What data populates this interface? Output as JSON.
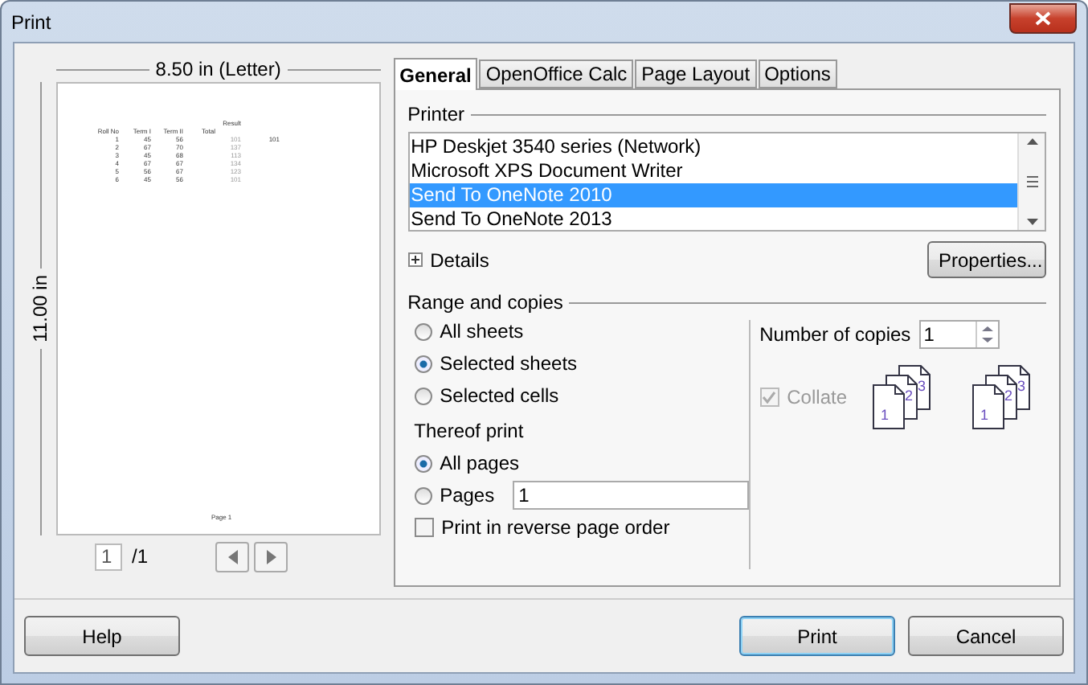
{
  "window": {
    "title": "Print"
  },
  "preview": {
    "width_label": "8.50 in (Letter)",
    "height_label": "11.00 in",
    "page": {
      "result_header": "Result",
      "headers": [
        "Roll No",
        "Term I",
        "Term II",
        "Total"
      ],
      "rows": [
        [
          "1",
          "45",
          "56",
          "101"
        ],
        [
          "2",
          "67",
          "70",
          "137"
        ],
        [
          "3",
          "45",
          "68",
          "113"
        ],
        [
          "4",
          "67",
          "67",
          "134"
        ],
        [
          "5",
          "56",
          "67",
          "123"
        ],
        [
          "6",
          "45",
          "56",
          "101"
        ]
      ],
      "side_value": "101",
      "footer": "Page 1"
    },
    "page_number": "1",
    "page_count": "/1"
  },
  "tabs": [
    {
      "label": "General",
      "selected": true
    },
    {
      "label": "OpenOffice Calc",
      "selected": false
    },
    {
      "label": "Page Layout",
      "selected": false
    },
    {
      "label": "Options",
      "selected": false
    }
  ],
  "printer": {
    "label": "Printer",
    "items": [
      {
        "name": "HP Deskjet 3540 series (Network)",
        "selected": false
      },
      {
        "name": "Microsoft XPS Document Writer",
        "selected": false
      },
      {
        "name": "Send To OneNote 2010",
        "selected": true
      },
      {
        "name": "Send To OneNote 2013",
        "selected": false
      }
    ],
    "details": "Details",
    "details_expanded": false,
    "properties": "Properties..."
  },
  "range": {
    "label": "Range and copies",
    "sheet_options": [
      {
        "label": "All sheets",
        "selected": false
      },
      {
        "label": "Selected sheets",
        "selected": true
      },
      {
        "label": "Selected cells",
        "selected": false
      }
    ],
    "thereof_label": "Thereof print",
    "page_options": [
      {
        "label": "All pages",
        "selected": true
      },
      {
        "label": "Pages",
        "selected": false
      }
    ],
    "pages_value": "1",
    "reverse": {
      "label": "Print in reverse page order",
      "checked": false
    },
    "copies_label": "Number of copies",
    "copies": "1",
    "collate": {
      "label": "Collate",
      "checked": true,
      "disabled": true
    },
    "collate_drawings": [
      {
        "pages": [
          "1",
          "2",
          "3"
        ]
      },
      {
        "pages": [
          "1",
          "2",
          "3"
        ]
      }
    ]
  },
  "buttons": {
    "help": "Help",
    "print": "Print",
    "cancel": "Cancel"
  }
}
